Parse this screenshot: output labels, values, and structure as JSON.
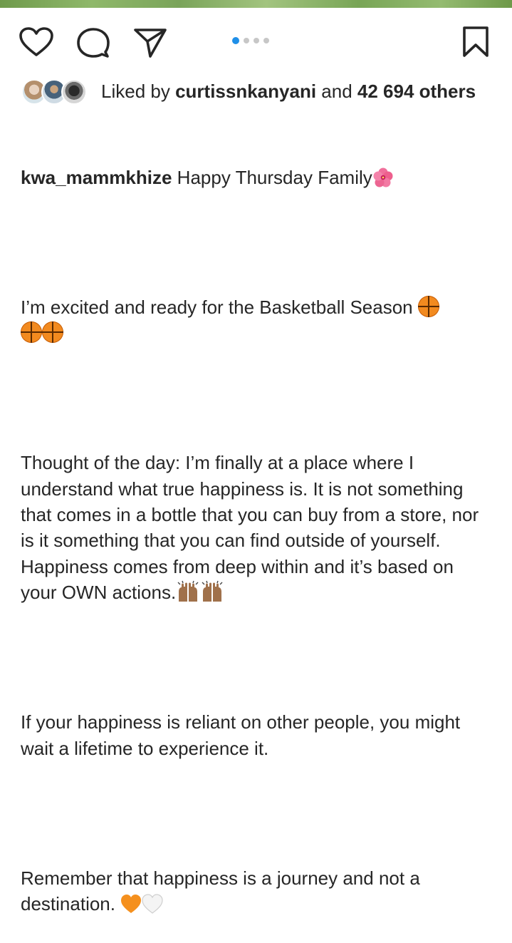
{
  "colors": {
    "accent_dot": "#1f8fe8",
    "inactive_dot": "#c7c7c7",
    "text": "#262626",
    "basketball": "#f28a1f"
  },
  "actions": {
    "icons": [
      "heart-icon",
      "comment-bubble-icon",
      "paper-plane-icon",
      "bookmark-icon"
    ],
    "carousel_pages": 4,
    "carousel_active_index": 1
  },
  "likes": {
    "prefix": "Liked by ",
    "username": "curtissnkanyani",
    "middle": " and ",
    "count": "42 694 others"
  },
  "caption": {
    "author": "kwa_mammkhize",
    "line1": " Happy Thursday Family",
    "para2": "I’m excited and ready for the Basketball Season ",
    "para3_a": "Thought of the day: I’m finally at a place where I understand what true happiness is. It is not something that comes in a bottle that you can buy from a store, nor is it something that you can find outside of yourself. Happiness comes from deep within and it’s based on your OWN actions.",
    "para4": "If your happiness is reliant on other people, you might wait a lifetime to experience it.",
    "para5": "Remember that happiness is a journey and not a destination. ",
    "emojis": [
      "hibiscus",
      "basketball",
      "basketball",
      "basketball",
      "raising-hands",
      "raising-hands",
      "orange-heart",
      "white-heart"
    ]
  }
}
